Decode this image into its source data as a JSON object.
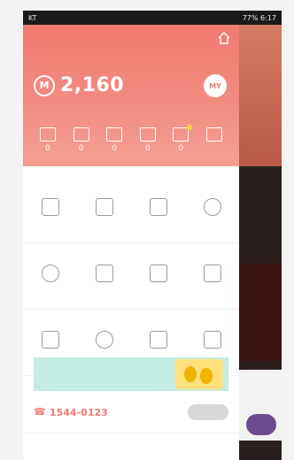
{
  "status_bar": {
    "left": "KT",
    "right": "77% 6:17"
  },
  "header": {
    "balance": "2,160",
    "amount_unit": "M",
    "action_label": "MY",
    "stats": [
      {
        "label": "",
        "value": "0"
      },
      {
        "label": "",
        "value": "0"
      },
      {
        "label": "",
        "value": "0"
      },
      {
        "label": "",
        "value": "0"
      },
      {
        "label": "",
        "value": "0"
      },
      {
        "label": "",
        "value": ""
      }
    ]
  },
  "menu": {
    "rows": [
      [
        {
          "icon": "film-icon",
          "label": ""
        },
        {
          "icon": "document-icon",
          "label": ""
        },
        {
          "icon": "ticket-icon",
          "label": ""
        },
        {
          "icon": "info-icon",
          "label": ""
        }
      ],
      [
        {
          "icon": "medal-icon",
          "label": ""
        },
        {
          "icon": "clock-icon",
          "label": ""
        },
        {
          "icon": "ticket-box-icon",
          "label": ""
        },
        {
          "icon": "gift-icon",
          "label": ""
        }
      ],
      [
        {
          "icon": "calendar-icon",
          "label": ""
        },
        {
          "icon": "location-icon",
          "label": ""
        },
        {
          "icon": "card-icon",
          "label": ""
        },
        {
          "icon": "phone-icon",
          "label": ""
        }
      ]
    ]
  },
  "banner": {
    "title": "",
    "subtitle": ""
  },
  "contact": {
    "phone": "1544-0123",
    "note": "",
    "button": ""
  },
  "footer": {
    "text": ""
  },
  "colors": {
    "accent": "#f17a70",
    "banner_bg": "#c5ebe5"
  }
}
